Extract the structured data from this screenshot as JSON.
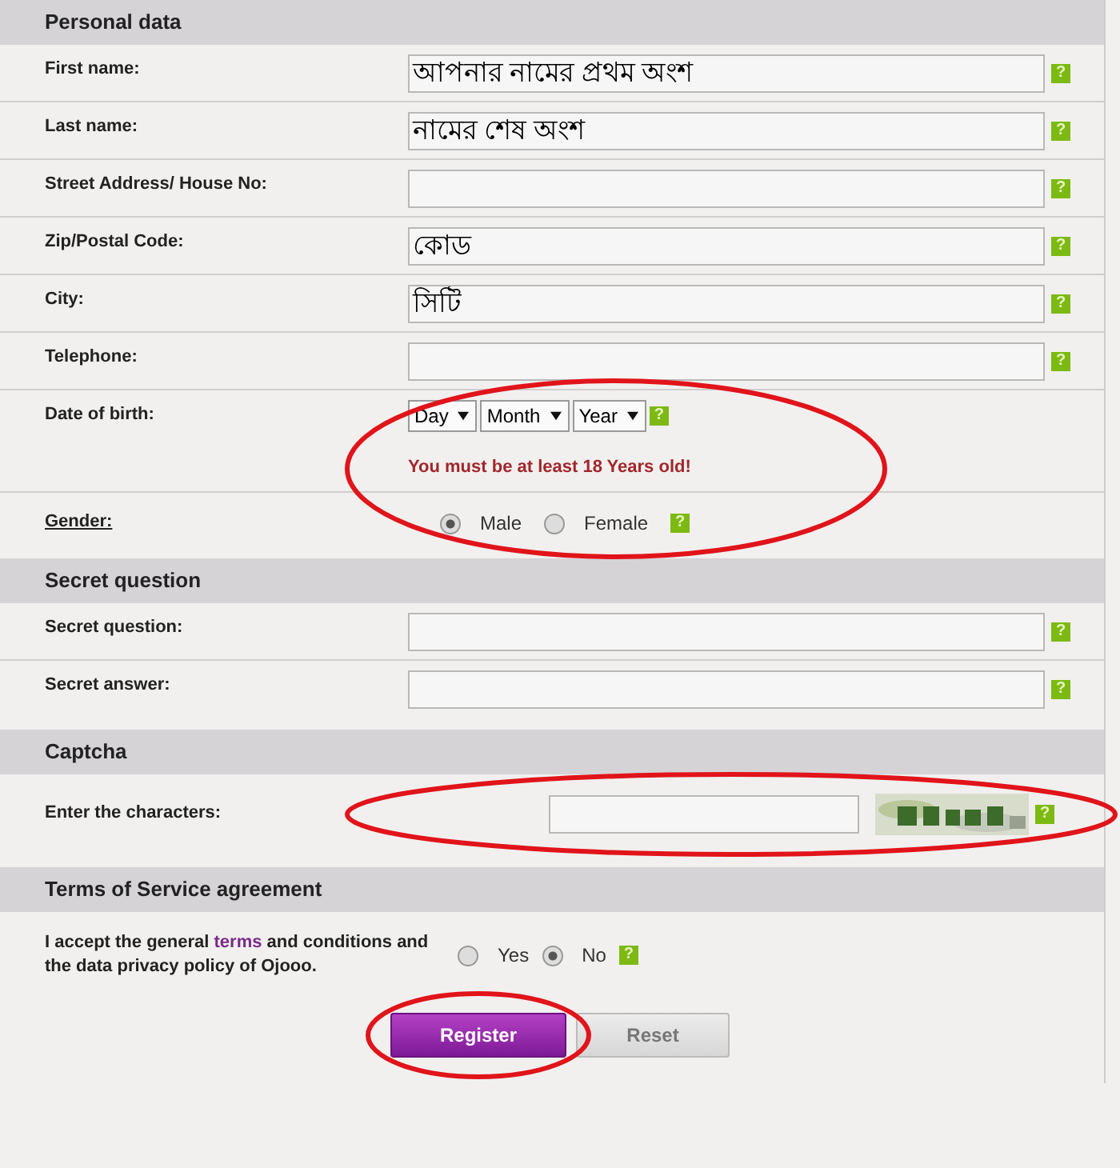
{
  "sections": [
    {
      "title": "Personal data",
      "rows": [
        {
          "kind": "text",
          "label": "First name:",
          "value": "আপনার নামের প্রথম অংশ",
          "help": "?"
        },
        {
          "kind": "text",
          "label": "Last name:",
          "value": "নামের শেষ অংশ",
          "help": "?"
        },
        {
          "kind": "text",
          "label": "Street Address/ House No:",
          "help": "?"
        },
        {
          "kind": "text",
          "label": "Zip/Postal Code:",
          "value": "কোড",
          "help": "?"
        },
        {
          "kind": "text",
          "label": "City:",
          "value": "সিটি",
          "help": "?"
        },
        {
          "kind": "text",
          "label": "Telephone:",
          "help": "?"
        },
        {
          "kind": "date",
          "label": "Date of birth:",
          "selects": [
            "Day",
            "Month",
            "Year"
          ],
          "note": "You must be at least 18 Years old!",
          "help": "?",
          "circled": true
        },
        {
          "kind": "radio",
          "label": "Gender:",
          "options": [
            {
              "label": "Male",
              "selected": true
            },
            {
              "label": "Female",
              "selected": false
            }
          ],
          "help": "?",
          "circled": true
        }
      ]
    },
    {
      "title": "Secret question",
      "rows": [
        {
          "kind": "text",
          "label": "Secret question:",
          "help": "?"
        },
        {
          "kind": "text",
          "label": "Secret answer:",
          "help": "?"
        }
      ]
    },
    {
      "title": "Captcha",
      "rows": [
        {
          "kind": "captcha",
          "label": "Enter the characters:",
          "help": "?",
          "circled": true
        }
      ]
    },
    {
      "title": "Terms of Service agreement",
      "rows": [
        {
          "kind": "terms",
          "before": "I accept the general ",
          "link": "terms",
          "after": " and conditions and the data privacy policy of Ojooo.",
          "options": [
            {
              "label": "Yes",
              "selected": false
            },
            {
              "label": "No",
              "selected": true
            }
          ],
          "help": "?"
        }
      ]
    }
  ],
  "buttons": [
    {
      "label": "Register",
      "kind": "primary",
      "circled": true
    },
    {
      "label": "Reset",
      "kind": "secondary",
      "circled": false
    }
  ]
}
